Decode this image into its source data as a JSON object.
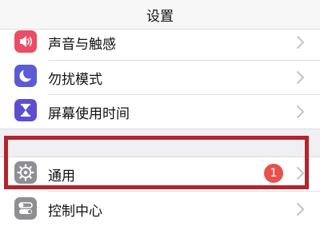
{
  "header": {
    "title": "设置"
  },
  "settings": {
    "items": [
      {
        "label": "声音与触感",
        "icon": "speaker-icon",
        "color": "#eb4d64"
      },
      {
        "label": "勿扰模式",
        "icon": "moon-icon",
        "color": "#5b5bd6"
      },
      {
        "label": "屏幕使用时间",
        "icon": "hourglass-icon",
        "color": "#5b4fd0"
      },
      {
        "label": "通用",
        "icon": "gear-icon",
        "color": "#8e8e93",
        "badge": "1"
      },
      {
        "label": "控制中心",
        "icon": "toggles-icon",
        "color": "#8e8e93"
      }
    ]
  },
  "colors": {
    "highlight_frame": "#b5242a",
    "badge": "#e6524c",
    "background": "#f2f2f7"
  }
}
